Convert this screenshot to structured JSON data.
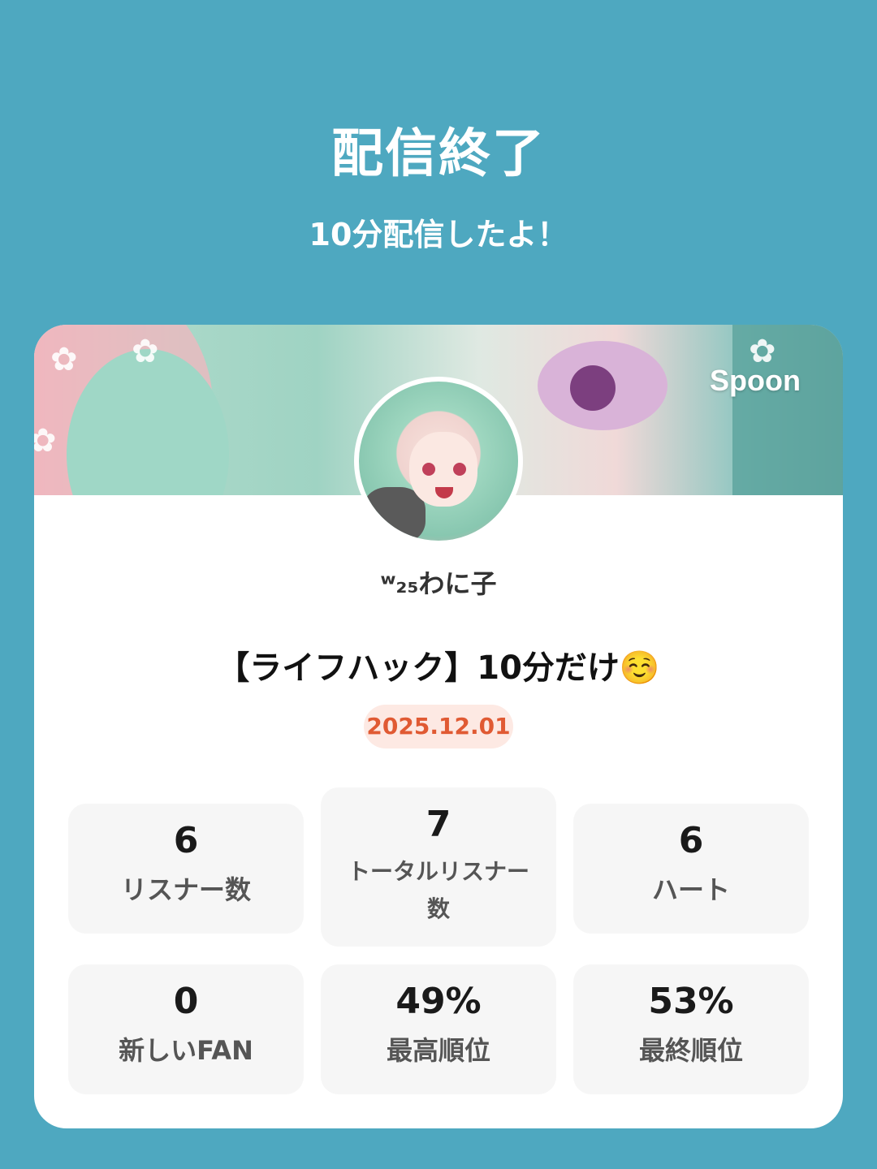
{
  "header": {
    "title": "配信終了",
    "subtitle": "10分配信したよ！"
  },
  "card": {
    "brand": "Spoon",
    "username": "ʷ₂₅わに子",
    "live_title": "【ライフハック】10分だけ☺️",
    "date": "2025.12.01",
    "date_color": "#e05a33",
    "stats": [
      {
        "value": "6",
        "label": "リスナー数"
      },
      {
        "value": "7",
        "label": "トータルリスナー数"
      },
      {
        "value": "6",
        "label": "ハート"
      },
      {
        "value": "0",
        "label": "新しいFAN"
      },
      {
        "value": "49%",
        "label": "最高順位"
      },
      {
        "value": "53%",
        "label": "最終順位"
      }
    ]
  },
  "colors": {
    "background": "#4ea8c0",
    "card": "#ffffff",
    "stat_bg": "#f6f6f6"
  }
}
